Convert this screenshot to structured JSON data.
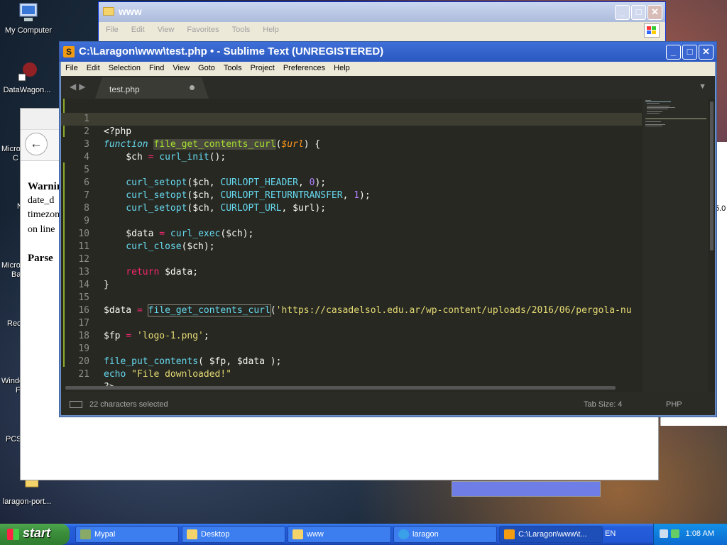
{
  "desktop": {
    "icons": [
      {
        "label": "My Computer"
      },
      {
        "label": "DataWagon..."
      },
      {
        "label": "laragon-port..."
      }
    ],
    "partial_labels": [
      "Micro",
      "C",
      "N",
      "Micro",
      "Ba",
      "Rec",
      "Windo",
      "F",
      "PCS"
    ]
  },
  "explorer": {
    "title": "www",
    "menu": [
      "File",
      "Edit",
      "View",
      "Favorites",
      "Tools",
      "Help"
    ]
  },
  "browser": {
    "back": "←",
    "lines": [
      "Warnin",
      "date_d",
      "timezon",
      "on line",
      "Parse"
    ]
  },
  "right_panel": {
    "version": "5.0"
  },
  "sublime": {
    "title": "C:\\Laragon\\www\\test.php • - Sublime Text (UNREGISTERED)",
    "icon_text": "S",
    "menu": [
      "File",
      "Edit",
      "Selection",
      "Find",
      "View",
      "Goto",
      "Tools",
      "Project",
      "Preferences",
      "Help"
    ],
    "tab_label": "test.php",
    "status": {
      "selection": "22 characters selected",
      "tab_size": "Tab Size: 4",
      "syntax": "PHP"
    },
    "line_numbers": [
      "1",
      "2",
      "3",
      "4",
      "5",
      "6",
      "7",
      "8",
      "9",
      "10",
      "11",
      "12",
      "13",
      "14",
      "15",
      "16",
      "17",
      "18",
      "19",
      "20",
      "21"
    ],
    "code": {
      "l1": "<?php",
      "l2_kw": "function",
      "l2_fn": "file_get_contents_curl",
      "l2_open": "(",
      "l2_arg": "$url",
      "l2_close": ") {",
      "l3_a": "    $ch ",
      "l3_op": "=",
      "l3_fn": " curl_init",
      "l3_b": "();",
      "l5_fn": "    curl_setopt",
      "l5_a": "($ch, ",
      "l5_c": "CURLOPT_HEADER",
      "l5_b": ", ",
      "l5_n": "0",
      "l5_e": ");",
      "l6_fn": "    curl_setopt",
      "l6_a": "($ch, ",
      "l6_c": "CURLOPT_RETURNTRANSFER",
      "l6_b": ", ",
      "l6_n": "1",
      "l6_e": ");",
      "l7_fn": "    curl_setopt",
      "l7_a": "($ch, ",
      "l7_c": "CURLOPT_URL",
      "l7_e": ", $url);",
      "l9_a": "    $data ",
      "l9_op": "=",
      "l9_fn": " curl_exec",
      "l9_b": "($ch);",
      "l10_fn": "    curl_close",
      "l10_b": "($ch);",
      "l12_kw": "    return",
      "l12_b": " $data;",
      "l13": "}",
      "l15_a": "$data ",
      "l15_op": "=",
      "l15_sp": " ",
      "l15_fn": "file_get_contents_curl",
      "l15_b": "(",
      "l15_str": "'https://casadelsol.edu.ar/wp-content/uploads/2016/06/pergola-nu",
      "l17_a": "$fp ",
      "l17_op": "=",
      "l17_str": " 'logo-1.png'",
      "l17_b": ";",
      "l19_fn": "file_put_contents",
      "l19_b": "( $fp, $data );",
      "l20_fn": "echo",
      "l20_str": " \"File downloaded!\"",
      "l21": "?>"
    }
  },
  "taskbar": {
    "start": "start",
    "items": [
      "Mypal",
      "Desktop",
      "www",
      "laragon",
      "C:\\Laragon\\www\\t..."
    ],
    "lang": "EN",
    "time": "1:08 AM"
  },
  "colors": {
    "editor_bg": "#272822",
    "keyword": "#66d9ef",
    "function": "#a6e22e",
    "string": "#e6db74",
    "number": "#ae81ff",
    "operator": "#f92672",
    "parameter": "#fd971f"
  }
}
